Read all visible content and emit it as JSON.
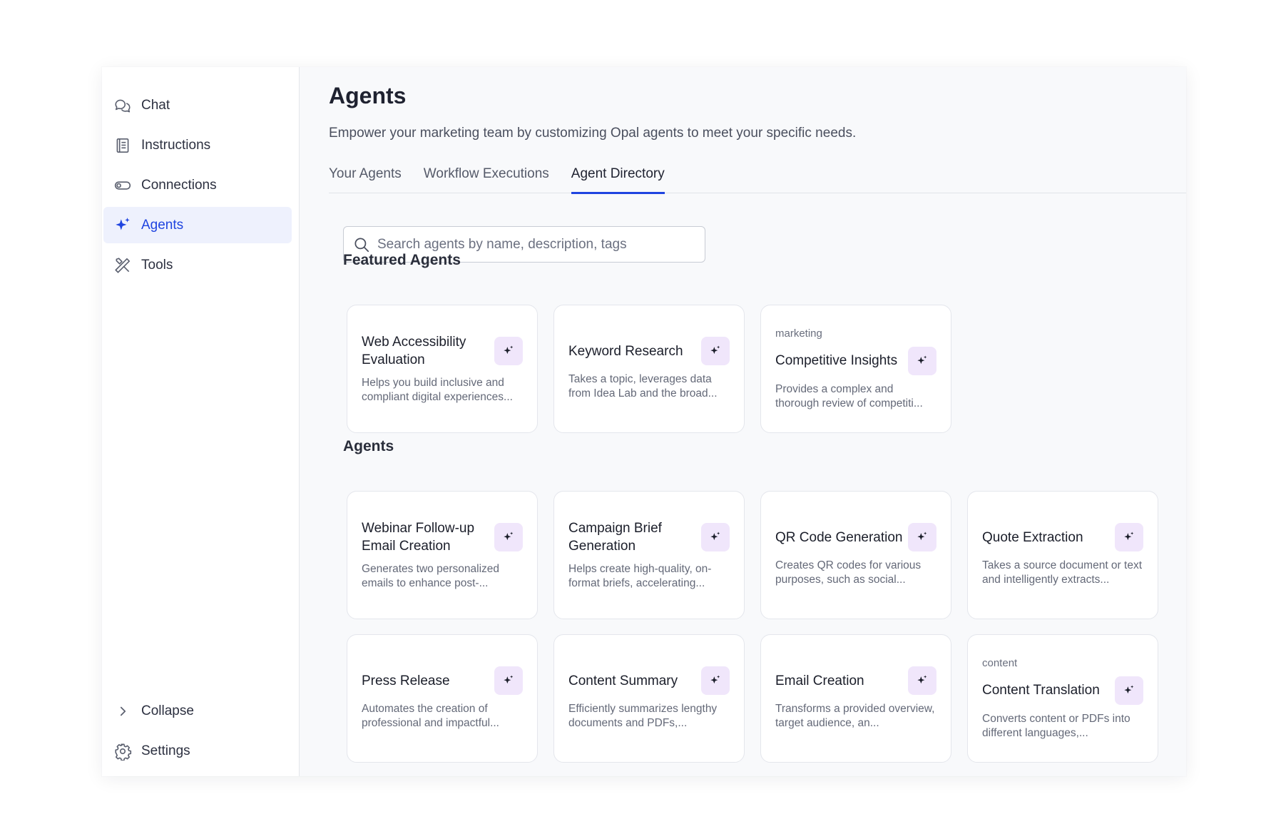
{
  "sidebar": {
    "items": [
      {
        "label": "Chat",
        "icon": "chat-icon"
      },
      {
        "label": "Instructions",
        "icon": "document-icon"
      },
      {
        "label": "Connections",
        "icon": "toggle-icon"
      },
      {
        "label": "Agents",
        "icon": "sparkle-icon",
        "active": true
      },
      {
        "label": "Tools",
        "icon": "tools-icon"
      }
    ],
    "footer": {
      "collapse_label": "Collapse",
      "settings_label": "Settings"
    }
  },
  "header": {
    "title": "Agents",
    "description": "Empower your marketing team by customizing Opal agents to meet your specific needs."
  },
  "tabs": [
    {
      "label": "Your Agents"
    },
    {
      "label": "Workflow Executions"
    },
    {
      "label": "Agent Directory",
      "active": true
    }
  ],
  "search": {
    "placeholder": "Search agents by name, description, tags",
    "value": ""
  },
  "featured": {
    "title": "Featured Agents",
    "cards": [
      {
        "tag": "",
        "title": "Web Accessibility Evaluation",
        "desc": "Helps you build inclusive and compliant digital experiences..."
      },
      {
        "tag": "",
        "title": "Keyword Research",
        "desc": "Takes a topic, leverages data from Idea Lab and the broad..."
      },
      {
        "tag": "marketing",
        "title": "Competitive Insights",
        "desc": "Provides a complex and thorough review of competiti..."
      }
    ]
  },
  "agents": {
    "title": "Agents",
    "rows": [
      [
        {
          "tag": "",
          "title": "Webinar Follow-up Email Creation",
          "desc": "Generates two personalized emails to enhance post-..."
        },
        {
          "tag": "",
          "title": "Campaign Brief Generation",
          "desc": "Helps create high-quality, on-format briefs, accelerating..."
        },
        {
          "tag": "",
          "title": "QR Code Generation",
          "desc": "Creates QR codes for various purposes, such as social..."
        },
        {
          "tag": "",
          "title": "Quote Extraction",
          "desc": "Takes a source document or text and intelligently extracts..."
        }
      ],
      [
        {
          "tag": "",
          "title": "Press Release",
          "desc": "Automates the creation of professional and impactful..."
        },
        {
          "tag": "",
          "title": "Content Summary",
          "desc": "Efficiently summarizes lengthy documents and PDFs,..."
        },
        {
          "tag": "",
          "title": "Email Creation",
          "desc": "Transforms a provided overview, target audience, an..."
        },
        {
          "tag": "content",
          "title": "Content Translation",
          "desc": "Converts content or PDFs into different languages,..."
        }
      ]
    ]
  },
  "colors": {
    "accent": "#1f44e0",
    "active_nav_bg": "#eef1fd",
    "spark_bg": "#f0e6fb"
  }
}
